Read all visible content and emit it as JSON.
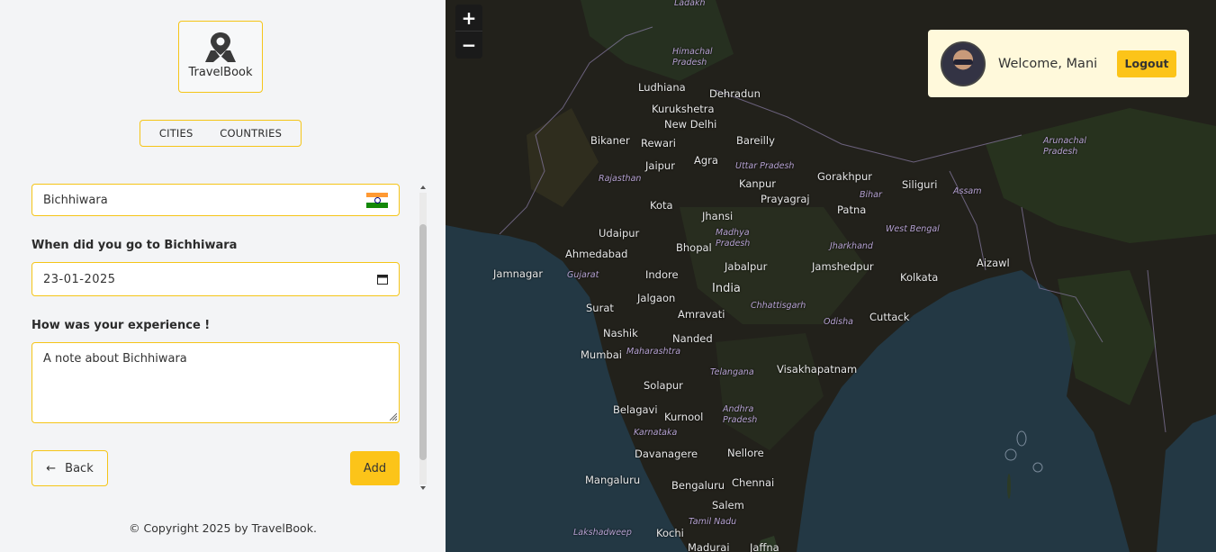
{
  "app": {
    "name": "TravelBook"
  },
  "tabs": [
    {
      "label": "CITIES"
    },
    {
      "label": "COUNTRIES"
    }
  ],
  "form": {
    "city_value": "Bichhiwara",
    "date_label": "When did you go to Bichhiwara",
    "date_value": "23-01-2025",
    "experience_label": "How was your experience !",
    "note_placeholder": "A note about Bichhiwara",
    "back_label": "Back",
    "add_label": "Add"
  },
  "footer": {
    "text": "© Copyright 2025 by TravelBook."
  },
  "user": {
    "welcome": "Welcome, Mani",
    "logout_label": "Logout"
  },
  "map": {
    "zoom_in": "+",
    "zoom_out": "−",
    "labels": [
      "Ladakh",
      "Himachal Pradesh",
      "Ludhiana",
      "Dehradun",
      "Kurukshetra",
      "New Delhi",
      "Bareilly",
      "Rewari",
      "Bikaner",
      "Jaipur",
      "Agra",
      "Uttar Pradesh",
      "Rajasthan",
      "Kanpur",
      "Kota",
      "Jhansi",
      "Prayagraj",
      "Bihar",
      "Patna",
      "Gorakhpur",
      "Siliguri",
      "Assam",
      "Udaipur",
      "Madhya Pradesh",
      "Ahmedabad",
      "Bhopal",
      "Jharkhand",
      "West Bengal",
      "Jamnagar",
      "Gujarat",
      "Indore",
      "Jabalpur",
      "Jamshedpur",
      "Kolkata",
      "India",
      "Jalgaon",
      "Surat",
      "Amravati",
      "Chhattisgarh",
      "Odisha",
      "Cuttack",
      "Nashik",
      "Nanded",
      "Maharashtra",
      "Mumbai",
      "Telangana",
      "Visakhapatnam",
      "Solapur",
      "Belagavi",
      "Kurnool",
      "Andhra Pradesh",
      "Karnataka",
      "Davanagere",
      "Nellore",
      "Mangaluru",
      "Bengaluru",
      "Chennai",
      "Salem",
      "Tamil Nadu",
      "Lakshadweep",
      "Kochi",
      "Madurai",
      "Jaffna",
      "Aizawl",
      "Arunachal Pradesh"
    ]
  }
}
